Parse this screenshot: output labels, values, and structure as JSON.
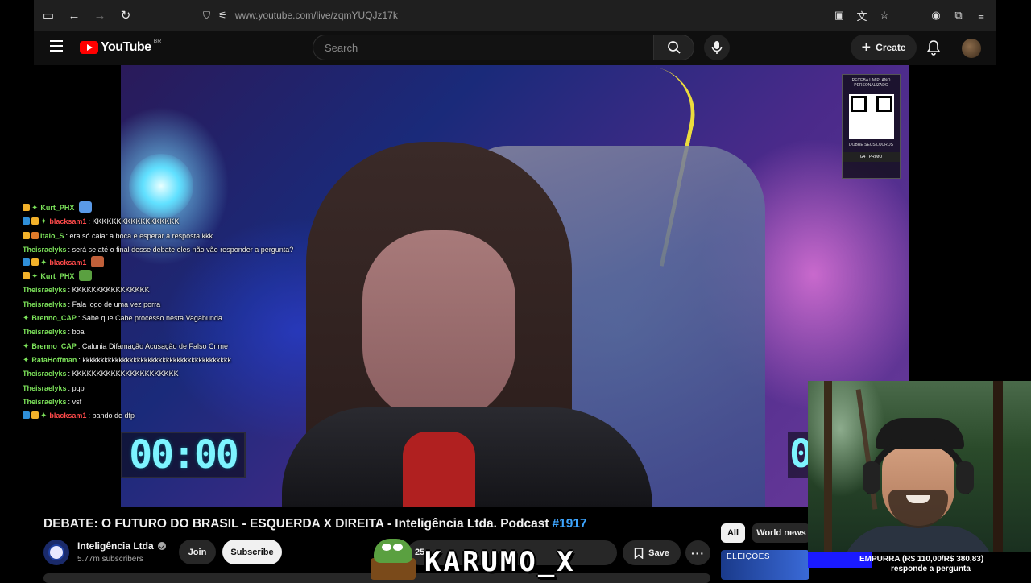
{
  "browser": {
    "url": "www.youtube.com/live/zqmYUQJz17k"
  },
  "header": {
    "logo_text": "YouTube",
    "country_code": "BR",
    "search_placeholder": "Search",
    "create_label": "Create"
  },
  "video": {
    "timer_main": "00:00",
    "timer_partial": "0",
    "qr_panel": {
      "top_text": "RECEBA UM PLANO PERSONALIZADO",
      "bottom_text": "DOBRE SEUS LUCROS",
      "brands": "G4 · PRIMO"
    }
  },
  "chat": {
    "messages": [
      {
        "badges": [
          "crown",
          "star"
        ],
        "nick": "Kurt_PHX",
        "nick_color": "#7ce25a",
        "text": "",
        "emote": "#5a9ae8"
      },
      {
        "badges": [
          "blue",
          "crown",
          "star"
        ],
        "nick": "blacksam1",
        "nick_color": "#ff4a4a",
        "text": "KKKKKKKKKKKKKKKKKK"
      },
      {
        "badges": [
          "crown",
          "gift"
        ],
        "nick": "italo_S",
        "nick_color": "#7ce25a",
        "text": "era só calar a boca e esperar a resposta kkk"
      },
      {
        "badges": [],
        "nick": "Theisraelyks",
        "nick_color": "#7ce25a",
        "text": "será se até o final desse debate eles não vão responder a pergunta?",
        "wrap": true
      },
      {
        "badges": [
          "blue",
          "crown",
          "star"
        ],
        "nick": "blacksam1",
        "nick_color": "#ff4a4a",
        "text": "",
        "emote": "#c0603a"
      },
      {
        "badges": [
          "crown",
          "star"
        ],
        "nick": "Kurt_PHX",
        "nick_color": "#7ce25a",
        "text": "",
        "emote": "#5aa040"
      },
      {
        "badges": [],
        "nick": "Theisraelyks",
        "nick_color": "#7ce25a",
        "text": "KKKKKKKKKKKKKKKK"
      },
      {
        "badges": [],
        "nick": "Theisraelyks",
        "nick_color": "#7ce25a",
        "text": "Fala logo de uma vez porra"
      },
      {
        "badges": [
          "star"
        ],
        "nick": "Brenno_CAP",
        "nick_color": "#7ce25a",
        "text": "Sabe que Cabe  processo nesta Vagabunda"
      },
      {
        "badges": [],
        "nick": "Theisraelyks",
        "nick_color": "#7ce25a",
        "text": "boa"
      },
      {
        "badges": [
          "star"
        ],
        "nick": "Brenno_CAP",
        "nick_color": "#7ce25a",
        "text": "Calunia Difamação Acusação de Falso Crime"
      },
      {
        "badges": [
          "star"
        ],
        "nick": "RafaHoffman",
        "nick_color": "#7ce25a",
        "text": "kkkkkkkkkkkkkkkkkkkkkkkkkkkkkkkkkkkkkkkkk"
      },
      {
        "badges": [],
        "nick": "Theisraelyks",
        "nick_color": "#7ce25a",
        "text": "KKKKKKKKKKKKKKKKKKKKKK"
      },
      {
        "badges": [],
        "nick": "Theisraelyks",
        "nick_color": "#7ce25a",
        "text": "pqp"
      },
      {
        "badges": [],
        "nick": "Theisraelyks",
        "nick_color": "#7ce25a",
        "text": "vsf"
      },
      {
        "badges": [
          "blue",
          "crown",
          "star"
        ],
        "nick": "blacksam1",
        "nick_color": "#ff4a4a",
        "text": "bando de dfp"
      }
    ]
  },
  "below": {
    "title": "DEBATE: O FUTURO DO BRASIL - ESQUERDA X DIREITA - Inteligência Ltda. Podcast",
    "title_tag": "#1917",
    "channel_name": "Inteligência Ltda",
    "subscribers": "5.77m subscribers",
    "join_label": "Join",
    "subscribe_label": "Subscribe",
    "like_count": "25",
    "save_label": "Save"
  },
  "sidebar": {
    "chips": [
      "All",
      "World news"
    ],
    "thumb_text": "ELEIÇÕES"
  },
  "overlay": {
    "streamer_name": "KARUMO_X",
    "push_text": "EMPURRA (R$ 110,00/R$ 380,83)",
    "push_progress": 0.29,
    "push_sub": "responde a pergunta"
  },
  "colors": {
    "accent_red": "#ff0000",
    "link_blue": "#3ea6ff",
    "timer_cyan": "#7df4ff",
    "push_blue": "#1a1aff"
  }
}
